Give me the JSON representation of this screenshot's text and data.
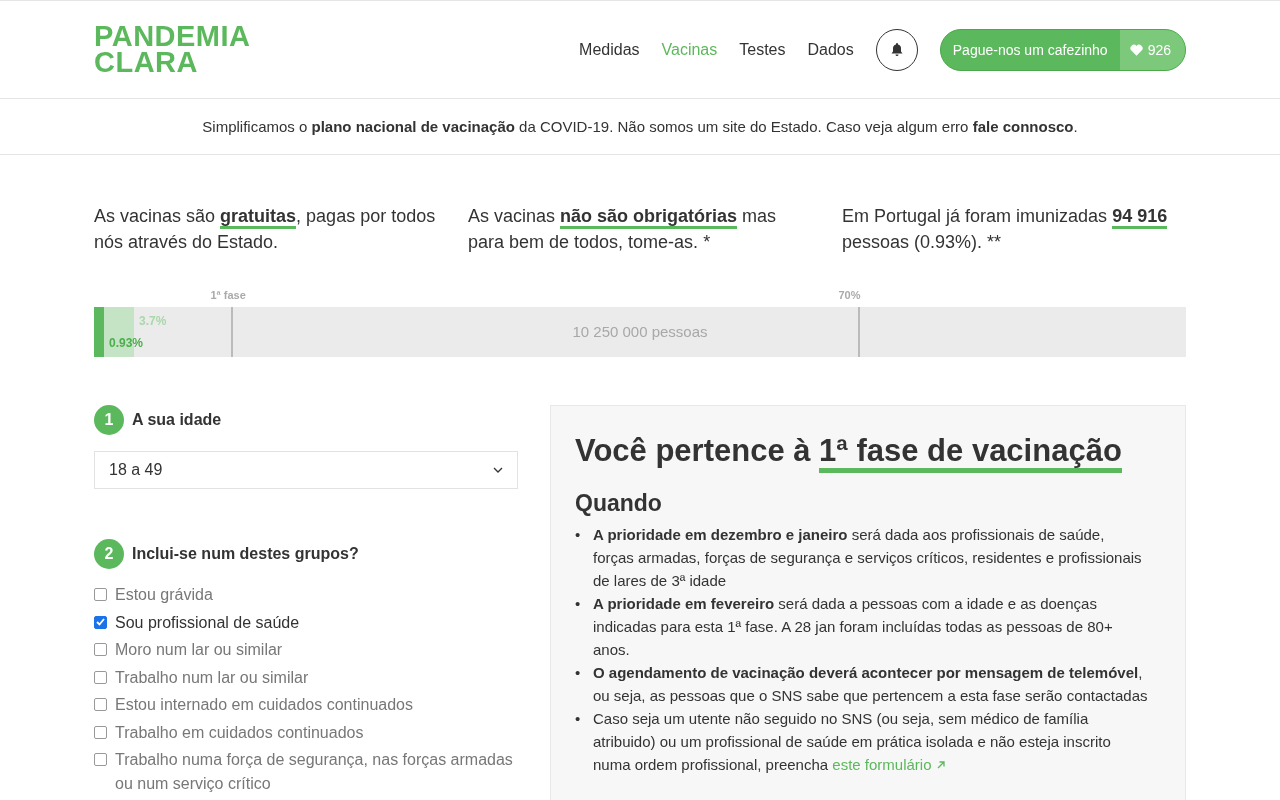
{
  "logo": [
    "PANDEMIA",
    "CLARA"
  ],
  "nav": [
    {
      "label": "Medidas",
      "selected": false
    },
    {
      "label": "Vacinas",
      "selected": true
    },
    {
      "label": "Testes",
      "selected": false
    },
    {
      "label": "Dados",
      "selected": false
    }
  ],
  "donate": {
    "label": "Pague-nos um cafezinho",
    "count": "926"
  },
  "banner": "Simplificamos o **plano nacional de vacinação** da COVID-19. Não somos um site do Estado. Caso veja algum erro **fale connosco**.",
  "facts": [
    "As vacinas são **gratuitas**, pagas por todos nós através do Estado.",
    "As vacinas **não são obrigatórias** mas para bem de todos, tome-as. *",
    "Em Portugal já foram imunizadas **94 916** pessoas (0.93%). **"
  ],
  "progress": {
    "markers": [
      "1ª fase",
      "70%"
    ],
    "total": "10 250 000 pessoas",
    "bars": [
      {
        "reading": "3.7%",
        "level": 0.037
      },
      {
        "reading": "0.93%",
        "level": 0.0093
      }
    ]
  },
  "steps": [
    {
      "number": "1",
      "title": "A sua idade"
    },
    {
      "number": "2",
      "title": "Inclui-se num destes grupos?"
    }
  ],
  "age_select": {
    "value": "18 a 49"
  },
  "groups": [
    {
      "label": "Estou grávida",
      "checked": false
    },
    {
      "label": "Sou profissional de saúde",
      "checked": true
    },
    {
      "label": "Moro num lar ou similar",
      "checked": false
    },
    {
      "label": "Trabalho num lar ou similar",
      "checked": false
    },
    {
      "label": "Estou internado em cuidados continuados",
      "checked": false
    },
    {
      "label": "Trabalho em cuidados continuados",
      "checked": false
    },
    {
      "label": "Trabalho numa força de segurança, nas forças armadas ou num serviço crítico",
      "checked": false
    }
  ],
  "result": {
    "title": "Você pertence à",
    "highlight": "1ª fase de vacinação",
    "section": "Quando",
    "bullets": [
      {
        "marker": "•",
        "text": "**A prioridade em dezembro e janeiro** será dada aos profissionais de saúde, forças armadas, forças de segurança e serviços críticos, residentes e profissionais de lares de 3ª idade"
      },
      {
        "marker": "•",
        "text": "**A prioridade em fevereiro** será dada a pessoas com a idade e as doenças indicadas para esta 1ª fase. A 28 jan foram incluídas todas as pessoas de 80+ anos."
      },
      {
        "marker": "•",
        "text": "**O agendamento de vacinação deverá acontecer por mensagem de telemóvel**, ou seja, as pessoas que o SNS sabe que pertencem a esta fase serão contactadas"
      },
      {
        "marker": "•",
        "text": "Caso seja um utente não seguido no SNS (ou seja, sem médico de família atribuido) ou um profissional de saúde em prática isolada e não esteja inscrito numa ordem profissional, preencha",
        "link": "este formulário"
      }
    ]
  }
}
